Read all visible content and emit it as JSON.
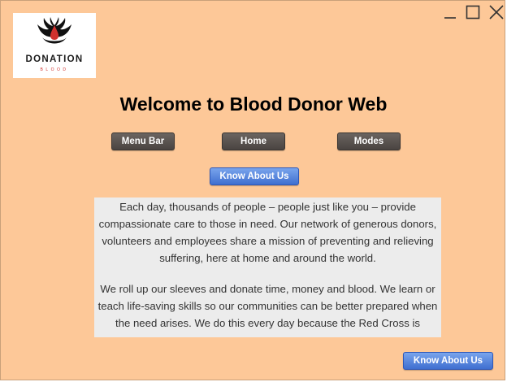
{
  "app": {
    "title": "Welcome to Blood Donor Web"
  },
  "logo": {
    "brand": "DONATION",
    "sub": "BLOOD"
  },
  "window_controls": {
    "minimize_icon": "minimize-icon",
    "maximize_icon": "maximize-icon",
    "close_icon": "close-icon"
  },
  "nav": {
    "menu_bar": "Menu Bar",
    "home": "Home",
    "modes": "Modes"
  },
  "buttons": {
    "know_about_top": "Know About Us",
    "know_about_bottom": "Know About Us"
  },
  "content": {
    "paragraph1": "Each day, thousands of people – people just like you – provide compassionate care to those in need. Our network of generous donors, volunteers and employees share a mission of preventing and relieving suffering, here at home and around the world.",
    "paragraph2": "We roll up our sleeves and donate time, money and blood. We learn or teach life-saving skills so our communities can be better prepared when the need arises. We do this every day because the Red Cross is"
  },
  "colors": {
    "background": "#fdc898",
    "nav_button": "#5a5350",
    "accent_blue": "#4f7fe0",
    "content_panel": "#ececec",
    "blood_red": "#d0312d"
  }
}
